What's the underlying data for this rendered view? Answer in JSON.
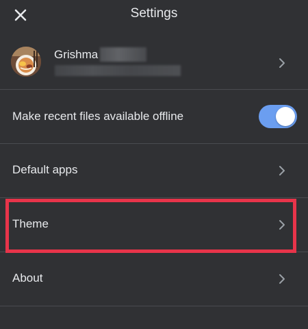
{
  "header": {
    "title": "Settings",
    "close_icon": "close-icon"
  },
  "account": {
    "name": "Grishma",
    "email": "",
    "avatar_icon": "avatar-photo"
  },
  "settings": {
    "offline": {
      "label": "Make recent files available offline",
      "enabled": true,
      "accent_color": "#6b9ef0"
    },
    "default_apps": {
      "label": "Default apps"
    },
    "theme": {
      "label": "Theme",
      "highlighted": true,
      "highlight_color": "#e8344a"
    },
    "about": {
      "label": "About"
    }
  },
  "colors": {
    "background": "#303134",
    "text": "#e8eaed",
    "divider": "#4a4c50",
    "chevron": "#9aa0a6"
  }
}
